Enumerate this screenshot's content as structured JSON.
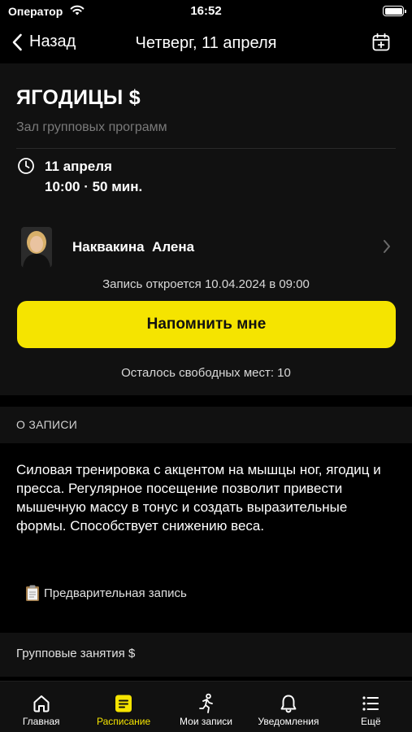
{
  "status_bar": {
    "carrier": "Оператор",
    "time": "16:52"
  },
  "nav": {
    "back_label": "Назад",
    "title": "Четверг, 11 апреля"
  },
  "class": {
    "title": "ЯГОДИЦЫ $",
    "hall": "Зал групповых программ",
    "date": "11 апреля",
    "time": "10:00 · 50 мин."
  },
  "trainer": {
    "name": "Наквакина  Алена"
  },
  "booking": {
    "note": "Запись откроется 10.04.2024 в 09:00",
    "remind_label": "Напомнить мне",
    "free_places": "Осталось свободных мест: 10"
  },
  "about": {
    "header": "О ЗАПИСИ",
    "description": "Силовая тренировка с акцентом на мышцы ног, ягодиц и пресса. Регулярное посещение позволит привести  мышечную массу в тонус и создать выразительные  формы. Способствует снижению веса.",
    "prebook_label": "Предварительная запись"
  },
  "group": {
    "label": "Групповые занятия $"
  },
  "tabs": [
    {
      "label": "Главная",
      "icon": "home-icon",
      "active": false
    },
    {
      "label": "Расписание",
      "icon": "schedule-icon",
      "active": true
    },
    {
      "label": "Мои записи",
      "icon": "runner-icon",
      "active": false
    },
    {
      "label": "Уведомления",
      "icon": "bell-icon",
      "active": false
    },
    {
      "label": "Ещё",
      "icon": "list-icon",
      "active": false
    }
  ],
  "colors": {
    "accent": "#f5e400",
    "background": "#000000",
    "card": "#111111",
    "muted_text": "#7a7a7a"
  }
}
